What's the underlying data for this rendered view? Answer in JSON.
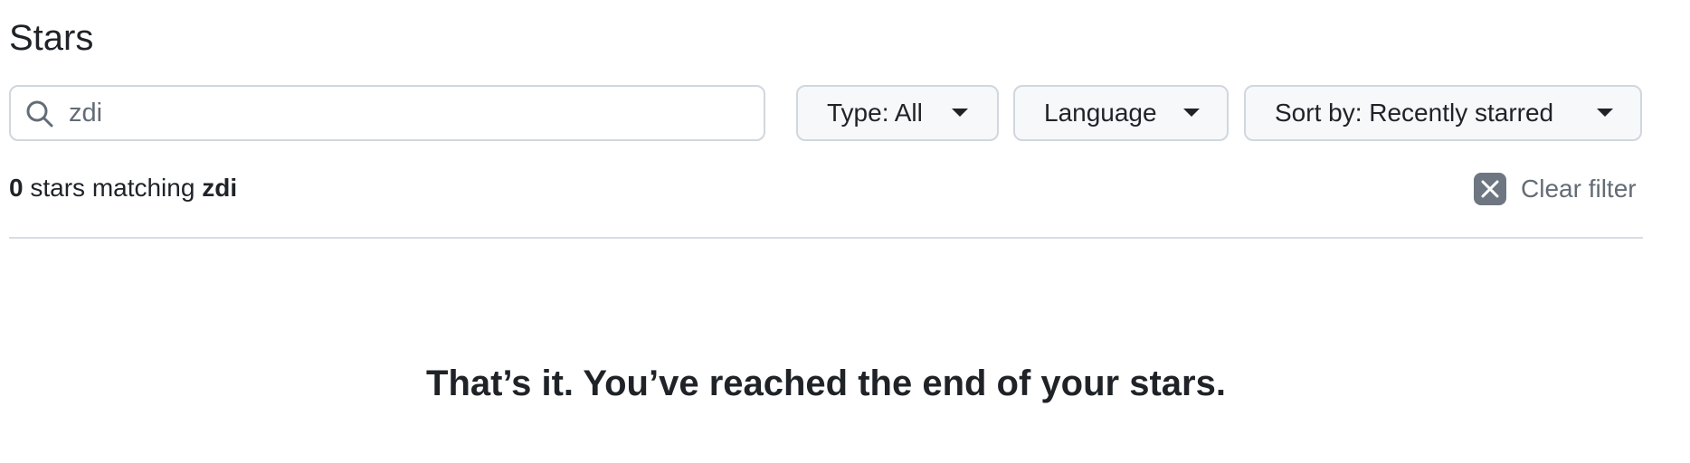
{
  "page": {
    "title": "Stars"
  },
  "search": {
    "value": "zdi",
    "icon": "search-icon"
  },
  "filters": {
    "type_label": "Type: All",
    "language_label": "Language",
    "sort_label": "Sort by: Recently starred"
  },
  "results": {
    "count": "0",
    "middle_text": " stars matching ",
    "query": "zdi"
  },
  "clear_filter": {
    "label": "Clear filter",
    "icon": "close-icon"
  },
  "end_message": "That’s it. You’ve reached the end of your stars.",
  "colors": {
    "text": "#1f2328",
    "muted": "#636c76",
    "border": "#d0d7de",
    "button_bg": "#f6f8fa",
    "clear_icon_bg": "#6e7781"
  }
}
